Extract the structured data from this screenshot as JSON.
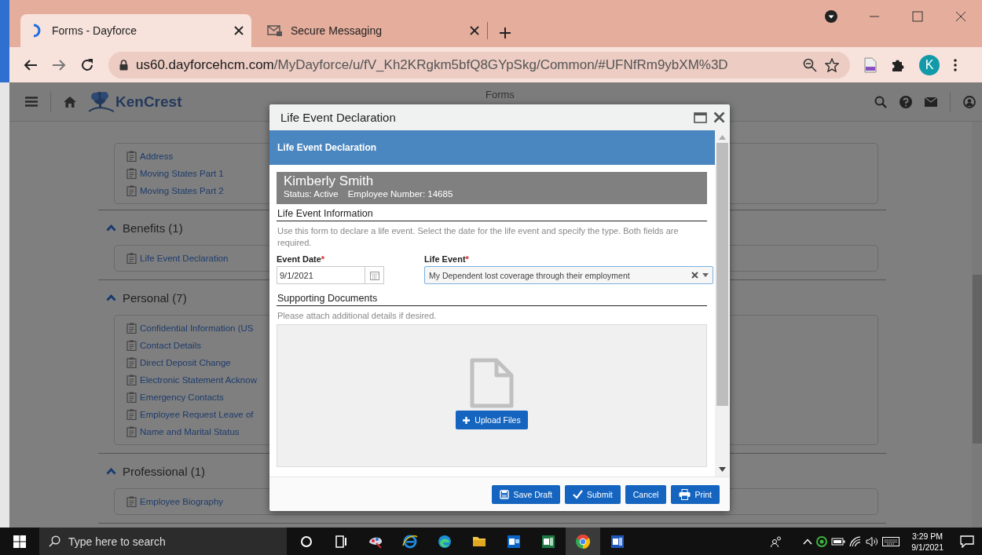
{
  "browser": {
    "tabs": [
      {
        "title": "Forms - Dayforce",
        "kind": "dayforce",
        "selected": true
      },
      {
        "title": "Secure Messaging",
        "kind": "mail",
        "selected": false
      }
    ],
    "url": {
      "host": "us60.dayforcehcm.com",
      "path": "/MyDayforce/u/fV_Kh2KRgkm5bfQ8GYpSkg/Common/#UFNfRm9ybXM%3D"
    },
    "profile_initial": "K"
  },
  "app_header": {
    "logo_text": "KenCrest",
    "page_title": "Forms"
  },
  "partial_group": {
    "forms": [
      "Address",
      "Moving States Part 1",
      "Moving States Part 2"
    ]
  },
  "groups": [
    {
      "title": "Benefits (1)",
      "expanded": true,
      "forms": [
        "Life Event Declaration"
      ]
    },
    {
      "title": "Personal (7)",
      "expanded": true,
      "forms": [
        "Confidential Information (US",
        "Contact Details",
        "Direct Deposit Change",
        "Electronic Statement Acknow",
        "Emergency Contacts",
        "Employee Request Leave of",
        "Name and Marital Status"
      ]
    },
    {
      "title": "Professional (1)",
      "expanded": true,
      "forms": [
        "Employee Biography"
      ]
    }
  ],
  "dialog": {
    "title": "Life Event Declaration",
    "form_title": "Life Event Declaration",
    "employee": {
      "name": "Kimberly Smith",
      "status": "Status: Active",
      "number": "Employee Number: 14685"
    },
    "info_heading": "Life Event Information",
    "info_text": "Use this form to declare a life event. Select the date for the life event and specify the type. Both fields are required.",
    "event_date": {
      "label": "Event Date",
      "required_mark": "*",
      "value": "9/1/2021"
    },
    "life_event": {
      "label": "Life Event",
      "required_mark": "*",
      "value": "My Dependent lost coverage through their employment",
      "focused": true
    },
    "docs_heading": "Supporting Documents",
    "docs_hint": "Please attach additional details if desired.",
    "upload_button": "Upload Files",
    "buttons": [
      {
        "label": "Save Draft",
        "kind": "save"
      },
      {
        "label": "Submit",
        "kind": "submit"
      },
      {
        "label": "Cancel",
        "kind": "cancel"
      },
      {
        "label": "Print",
        "kind": "print"
      }
    ]
  },
  "taskbar": {
    "search_placeholder": "Type here to search",
    "apps": [
      {
        "kind": "cortana",
        "active": false
      },
      {
        "kind": "taskview",
        "active": false
      },
      {
        "kind": "paint",
        "active": false
      },
      {
        "kind": "ie",
        "active": false
      },
      {
        "kind": "edge",
        "active": false
      },
      {
        "kind": "explorer",
        "active": false
      },
      {
        "kind": "outlook",
        "active": false
      },
      {
        "kind": "excel",
        "active": false
      },
      {
        "kind": "chrome",
        "active": true
      },
      {
        "kind": "word",
        "active": false
      }
    ],
    "time": "3:29 PM",
    "date": "9/1/2021"
  }
}
